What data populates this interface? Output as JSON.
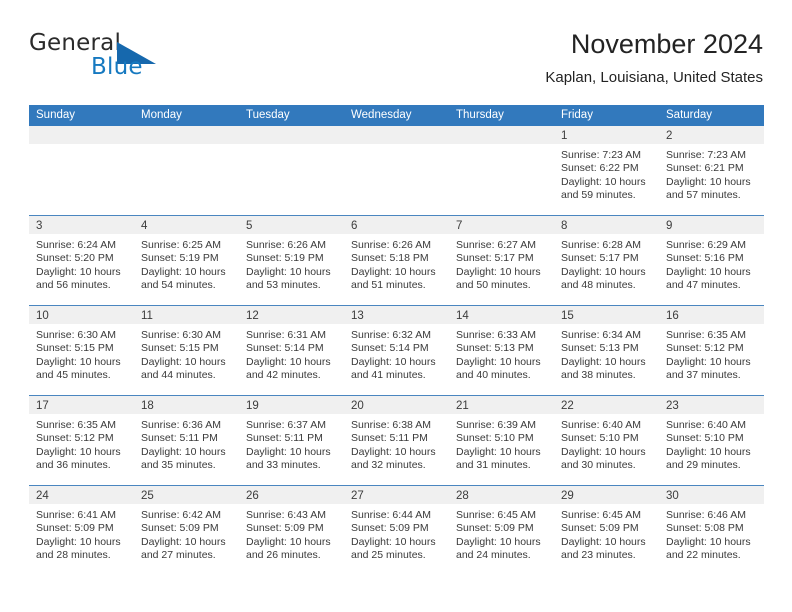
{
  "brand": {
    "name_top": "General",
    "name_bottom": "Blue",
    "accent_color": "#1679c0",
    "triangle_color": "#1668ad"
  },
  "header": {
    "title": "November 2024",
    "subtitle": "Kaplan, Louisiana, United States"
  },
  "theme": {
    "header_row_bg": "#3279bd",
    "header_row_text": "#ffffff",
    "daynum_band_bg": "#f0f0f0",
    "row_border": "#4a86c0",
    "body_text": "#3a3a3a"
  },
  "calendar": {
    "weekday_headers": [
      "Sunday",
      "Monday",
      "Tuesday",
      "Wednesday",
      "Thursday",
      "Friday",
      "Saturday"
    ],
    "weeks": [
      [
        {
          "day": "",
          "empty": true
        },
        {
          "day": "",
          "empty": true
        },
        {
          "day": "",
          "empty": true
        },
        {
          "day": "",
          "empty": true
        },
        {
          "day": "",
          "empty": true
        },
        {
          "day": "1",
          "sunrise": "Sunrise: 7:23 AM",
          "sunset": "Sunset: 6:22 PM",
          "daylight": "Daylight: 10 hours and 59 minutes."
        },
        {
          "day": "2",
          "sunrise": "Sunrise: 7:23 AM",
          "sunset": "Sunset: 6:21 PM",
          "daylight": "Daylight: 10 hours and 57 minutes."
        }
      ],
      [
        {
          "day": "3",
          "sunrise": "Sunrise: 6:24 AM",
          "sunset": "Sunset: 5:20 PM",
          "daylight": "Daylight: 10 hours and 56 minutes."
        },
        {
          "day": "4",
          "sunrise": "Sunrise: 6:25 AM",
          "sunset": "Sunset: 5:19 PM",
          "daylight": "Daylight: 10 hours and 54 minutes."
        },
        {
          "day": "5",
          "sunrise": "Sunrise: 6:26 AM",
          "sunset": "Sunset: 5:19 PM",
          "daylight": "Daylight: 10 hours and 53 minutes."
        },
        {
          "day": "6",
          "sunrise": "Sunrise: 6:26 AM",
          "sunset": "Sunset: 5:18 PM",
          "daylight": "Daylight: 10 hours and 51 minutes."
        },
        {
          "day": "7",
          "sunrise": "Sunrise: 6:27 AM",
          "sunset": "Sunset: 5:17 PM",
          "daylight": "Daylight: 10 hours and 50 minutes."
        },
        {
          "day": "8",
          "sunrise": "Sunrise: 6:28 AM",
          "sunset": "Sunset: 5:17 PM",
          "daylight": "Daylight: 10 hours and 48 minutes."
        },
        {
          "day": "9",
          "sunrise": "Sunrise: 6:29 AM",
          "sunset": "Sunset: 5:16 PM",
          "daylight": "Daylight: 10 hours and 47 minutes."
        }
      ],
      [
        {
          "day": "10",
          "sunrise": "Sunrise: 6:30 AM",
          "sunset": "Sunset: 5:15 PM",
          "daylight": "Daylight: 10 hours and 45 minutes."
        },
        {
          "day": "11",
          "sunrise": "Sunrise: 6:30 AM",
          "sunset": "Sunset: 5:15 PM",
          "daylight": "Daylight: 10 hours and 44 minutes."
        },
        {
          "day": "12",
          "sunrise": "Sunrise: 6:31 AM",
          "sunset": "Sunset: 5:14 PM",
          "daylight": "Daylight: 10 hours and 42 minutes."
        },
        {
          "day": "13",
          "sunrise": "Sunrise: 6:32 AM",
          "sunset": "Sunset: 5:14 PM",
          "daylight": "Daylight: 10 hours and 41 minutes."
        },
        {
          "day": "14",
          "sunrise": "Sunrise: 6:33 AM",
          "sunset": "Sunset: 5:13 PM",
          "daylight": "Daylight: 10 hours and 40 minutes."
        },
        {
          "day": "15",
          "sunrise": "Sunrise: 6:34 AM",
          "sunset": "Sunset: 5:13 PM",
          "daylight": "Daylight: 10 hours and 38 minutes."
        },
        {
          "day": "16",
          "sunrise": "Sunrise: 6:35 AM",
          "sunset": "Sunset: 5:12 PM",
          "daylight": "Daylight: 10 hours and 37 minutes."
        }
      ],
      [
        {
          "day": "17",
          "sunrise": "Sunrise: 6:35 AM",
          "sunset": "Sunset: 5:12 PM",
          "daylight": "Daylight: 10 hours and 36 minutes."
        },
        {
          "day": "18",
          "sunrise": "Sunrise: 6:36 AM",
          "sunset": "Sunset: 5:11 PM",
          "daylight": "Daylight: 10 hours and 35 minutes."
        },
        {
          "day": "19",
          "sunrise": "Sunrise: 6:37 AM",
          "sunset": "Sunset: 5:11 PM",
          "daylight": "Daylight: 10 hours and 33 minutes."
        },
        {
          "day": "20",
          "sunrise": "Sunrise: 6:38 AM",
          "sunset": "Sunset: 5:11 PM",
          "daylight": "Daylight: 10 hours and 32 minutes."
        },
        {
          "day": "21",
          "sunrise": "Sunrise: 6:39 AM",
          "sunset": "Sunset: 5:10 PM",
          "daylight": "Daylight: 10 hours and 31 minutes."
        },
        {
          "day": "22",
          "sunrise": "Sunrise: 6:40 AM",
          "sunset": "Sunset: 5:10 PM",
          "daylight": "Daylight: 10 hours and 30 minutes."
        },
        {
          "day": "23",
          "sunrise": "Sunrise: 6:40 AM",
          "sunset": "Sunset: 5:10 PM",
          "daylight": "Daylight: 10 hours and 29 minutes."
        }
      ],
      [
        {
          "day": "24",
          "sunrise": "Sunrise: 6:41 AM",
          "sunset": "Sunset: 5:09 PM",
          "daylight": "Daylight: 10 hours and 28 minutes."
        },
        {
          "day": "25",
          "sunrise": "Sunrise: 6:42 AM",
          "sunset": "Sunset: 5:09 PM",
          "daylight": "Daylight: 10 hours and 27 minutes."
        },
        {
          "day": "26",
          "sunrise": "Sunrise: 6:43 AM",
          "sunset": "Sunset: 5:09 PM",
          "daylight": "Daylight: 10 hours and 26 minutes."
        },
        {
          "day": "27",
          "sunrise": "Sunrise: 6:44 AM",
          "sunset": "Sunset: 5:09 PM",
          "daylight": "Daylight: 10 hours and 25 minutes."
        },
        {
          "day": "28",
          "sunrise": "Sunrise: 6:45 AM",
          "sunset": "Sunset: 5:09 PM",
          "daylight": "Daylight: 10 hours and 24 minutes."
        },
        {
          "day": "29",
          "sunrise": "Sunrise: 6:45 AM",
          "sunset": "Sunset: 5:09 PM",
          "daylight": "Daylight: 10 hours and 23 minutes."
        },
        {
          "day": "30",
          "sunrise": "Sunrise: 6:46 AM",
          "sunset": "Sunset: 5:08 PM",
          "daylight": "Daylight: 10 hours and 22 minutes."
        }
      ]
    ]
  }
}
